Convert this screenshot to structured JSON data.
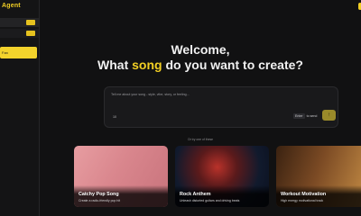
{
  "app": {
    "brand": "Agent"
  },
  "sidebar": {
    "active_label": "Fan"
  },
  "hero": {
    "welcome": "Welcome,",
    "question_before": "What ",
    "question_highlight": "song",
    "question_after": " do you want to create?"
  },
  "prompt": {
    "placeholder": "Tell me about your song - style, vibe, story, or feeling...",
    "tool_label": "10",
    "enter_key": "Enter",
    "enter_hint": "to send"
  },
  "helper_text": "Or try one of these",
  "cards": [
    {
      "title": "Catchy Pop Song",
      "desc": "Create a radio-friendly pop hit"
    },
    {
      "title": "Rock Anthem",
      "desc": "Unleash distorted guitars and driving beats"
    },
    {
      "title": "Workout Motivation",
      "desc": "High energy motivational track"
    }
  ],
  "colors": {
    "accent": "#f2cf24",
    "background": "#111112"
  }
}
